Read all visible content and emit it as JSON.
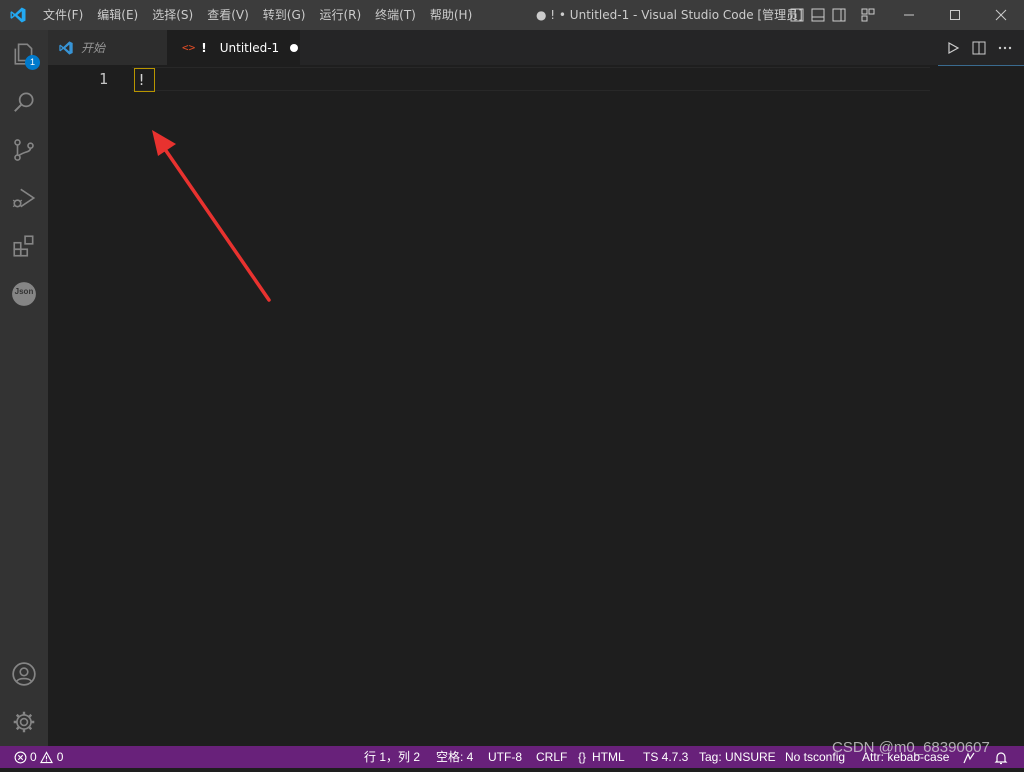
{
  "titlebar": {
    "menu": [
      "文件(F)",
      "编辑(E)",
      "选择(S)",
      "查看(V)",
      "转到(G)",
      "运行(R)",
      "终端(T)",
      "帮助(H)"
    ],
    "window_title": "● ! • Untitled-1 - Visual Studio Code [管理员]"
  },
  "activity_bar": {
    "explorer_badge": "1",
    "json_label": "Json"
  },
  "tabs": [
    {
      "label": "开始",
      "active": false
    },
    {
      "label": "Untitled-1",
      "prefix": "!",
      "active": true,
      "dirty": true
    }
  ],
  "editor": {
    "line_numbers": [
      "1"
    ],
    "lines": [
      "!"
    ]
  },
  "statusbar": {
    "errors": "0",
    "warnings": "0",
    "cursor": "行 1，列 2",
    "indent": "空格: 4",
    "encoding": "UTF-8",
    "eol": "CRLF",
    "language": "HTML",
    "ts_version": "TS 4.7.3",
    "tag": "Tag: UNSURE",
    "tsconfig": "No tsconfig",
    "attr": "Attr: kebab-case"
  },
  "watermark": "CSDN @m0_68390607",
  "colors": {
    "statusbar": "#68217a",
    "activitybar": "#333333",
    "titlebar": "#3c3c3c",
    "editor_bg": "#1e1e1e",
    "accent": "#007acc",
    "arrow": "#e8322f"
  }
}
